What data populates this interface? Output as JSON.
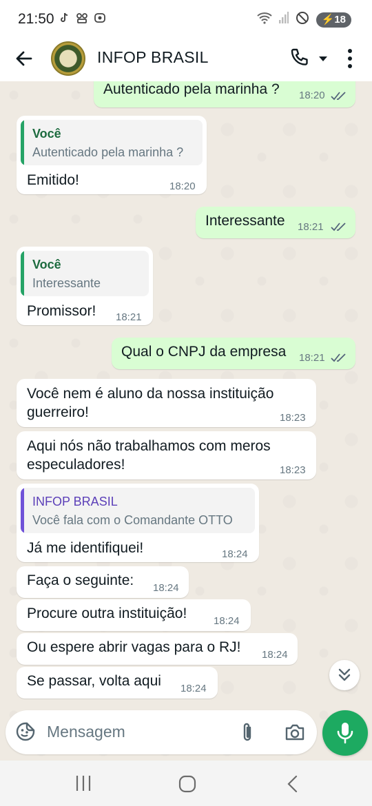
{
  "status_bar": {
    "time": "21:50",
    "battery": "18",
    "left_icons": [
      "tiktok-icon",
      "voicemail-icon",
      "instagram-icon"
    ],
    "right_icons": [
      "wifi-icon",
      "signal-icon",
      "do-not-disturb-icon",
      "battery-charging-icon"
    ]
  },
  "header": {
    "contact_name": "INFOP BRASIL",
    "icons": [
      "back-arrow-icon",
      "avatar",
      "phone-icon",
      "caret-down-icon",
      "more-vert-icon"
    ]
  },
  "messages": [
    {
      "dir": "out",
      "text": "Autenticado pela marinha ?",
      "time": "18:20",
      "read": true
    },
    {
      "dir": "in",
      "quote_author": "Você",
      "quote_text": "Autenticado pela marinha ?",
      "text": "Emitido!",
      "time": "18:20"
    },
    {
      "dir": "out",
      "text": "Interessante",
      "time": "18:21",
      "read": true
    },
    {
      "dir": "in",
      "quote_author": "Você",
      "quote_text": "Interessante",
      "text": "Promissor!",
      "time": "18:21"
    },
    {
      "dir": "out",
      "text": "Qual o CNPJ da empresa",
      "time": "18:21",
      "read": true
    },
    {
      "dir": "in",
      "text_line1": "Você nem é aluno da nossa instituição",
      "text_line2": "guerreiro!",
      "time": "18:23"
    },
    {
      "dir": "in",
      "text_line1": "Aqui nós não trabalhamos com meros",
      "text_line2": "especuladores!",
      "time": "18:23"
    },
    {
      "dir": "in",
      "quote_author": "INFOP BRASIL",
      "quote_text": "Você fala com o Comandante OTTO",
      "text": "Já me identifiquei!",
      "time": "18:24"
    },
    {
      "dir": "in",
      "text": "Faça o seguinte:",
      "time": "18:24"
    },
    {
      "dir": "in",
      "text": "Procure outra instituição!",
      "time": "18:24"
    },
    {
      "dir": "in",
      "text": "Ou espere abrir vagas para o RJ!",
      "time": "18:24"
    },
    {
      "dir": "in",
      "text": "Se passar, volta aqui",
      "time": "18:24"
    }
  ],
  "composer": {
    "placeholder": "Mensagem",
    "icons": [
      "emoji-sticker-icon",
      "paperclip-icon",
      "camera-icon",
      "mic-icon"
    ]
  },
  "colors": {
    "outgoing_bubble": "#d9fdd3",
    "incoming_bubble": "#ffffff",
    "chat_background": "#efeae2",
    "self_quote_bar": "#25a366",
    "contact_quote_bar": "#6f52d8",
    "contact_quote_author": "#5b3fb8",
    "self_quote_author": "#1d6b3f",
    "read_ticks": "#53637a",
    "mic_button": "#1daa61"
  }
}
